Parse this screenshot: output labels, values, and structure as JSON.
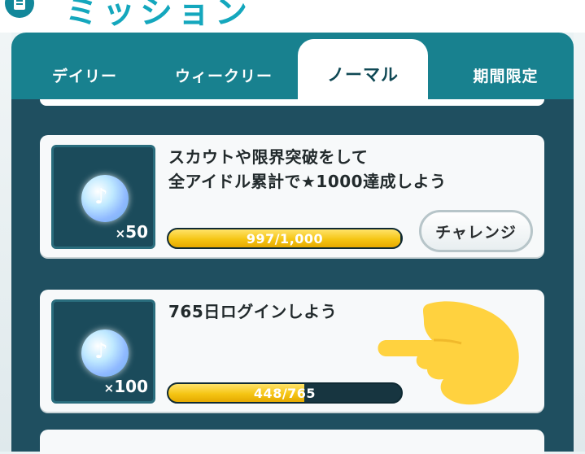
{
  "header": {
    "title": "ミッション",
    "icon": "list-icon"
  },
  "tabs": [
    {
      "label": "デイリー",
      "active": false
    },
    {
      "label": "ウィークリー",
      "active": false
    },
    {
      "label": "ノーマル",
      "active": true
    },
    {
      "label": "期間限定",
      "active": false
    }
  ],
  "missions": [
    {
      "text_line1": "スカウトや限界突破をして",
      "text_line2": "全アイドル累計で★1000達成しよう",
      "reward_icon": "jewel-icon",
      "reward_prefix": "×",
      "reward_count": "50",
      "progress_text": "997/1,000",
      "progress_fraction": 0.997,
      "button_label": "チャレンジ"
    },
    {
      "text_line1": "765日ログインしよう",
      "reward_icon": "jewel-icon",
      "reward_prefix": "×",
      "reward_count": "100",
      "progress_text": "448/765",
      "progress_fraction": 0.5856
    }
  ],
  "overlay": {
    "icon": "pointing-hand-emoji-icon",
    "color": "#ffd23f"
  },
  "colors": {
    "accent": "#14a7bd",
    "panel": "#18818f",
    "content_bg": "#1f4f60",
    "progress_fill": "#f5c514"
  }
}
